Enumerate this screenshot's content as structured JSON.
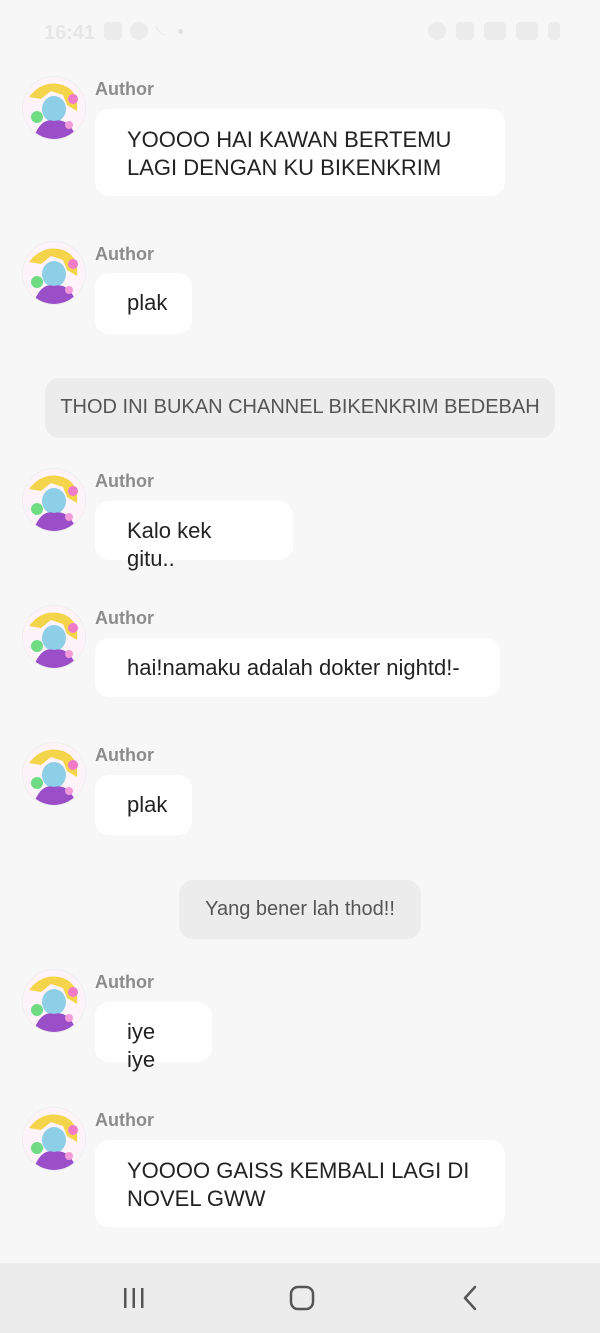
{
  "status_bar": {
    "time": "16:41"
  },
  "messages": [
    {
      "kind": "author",
      "author": "Author",
      "text": "YOOOO HAI KAWAN BERTEMU LAGI DENGAN KU BIKENKRIM"
    },
    {
      "kind": "author",
      "author": "Author",
      "text": "plak"
    },
    {
      "kind": "narration",
      "text": "THOD INI BUKAN CHANNEL BIKENKRIM BEDEBAH"
    },
    {
      "kind": "author",
      "author": "Author",
      "text": "Kalo kek gitu.."
    },
    {
      "kind": "author",
      "author": "Author",
      "text": "hai!namaku adalah dokter nightd!-"
    },
    {
      "kind": "author",
      "author": "Author",
      "text": "plak"
    },
    {
      "kind": "narration",
      "text": "Yang bener lah thod!!"
    },
    {
      "kind": "author",
      "author": "Author",
      "text": "iye iye"
    },
    {
      "kind": "author",
      "author": "Author",
      "text": "YOOOO GAISS KEMBALI LAGI DI NOVEL GWW"
    }
  ],
  "nav": {
    "recents_icon": "recents-icon",
    "home_icon": "home-icon",
    "back_icon": "back-icon"
  },
  "colors": {
    "background": "#f7f7f7",
    "bubble": "#ffffff",
    "narration_bg": "#ececec",
    "author_label": "#8c8c8c",
    "nav_bg": "#ececec"
  }
}
